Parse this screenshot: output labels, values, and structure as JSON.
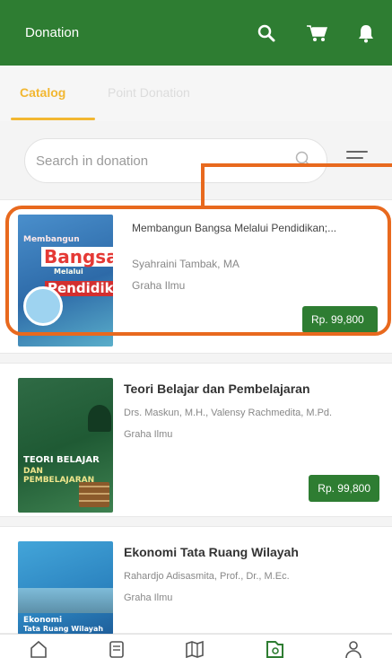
{
  "app": {
    "title": "Donation",
    "icons": [
      "search-icon",
      "cart-icon",
      "bell-icon"
    ]
  },
  "tabs": {
    "catalog": "Catalog",
    "point_donation": "Point Donation"
  },
  "search": {
    "placeholder": "Search in donation"
  },
  "books": [
    {
      "title": "Membangun Bangsa Melalui Pendidikan;...",
      "author": "Syahraini Tambak, MA",
      "publisher": "Graha Ilmu",
      "price": "Rp. 99,800",
      "cover_text": [
        "Membangun",
        "Bangsa",
        "Melalui",
        "Pendidikan"
      ]
    },
    {
      "title": "Teori Belajar dan Pembelajaran",
      "author": "Drs. Maskun, M.H., Valensy Rachmedita, M.Pd.",
      "publisher": "Graha Ilmu",
      "price": "Rp. 99,800",
      "cover_text": [
        "TEORI BELAJAR",
        "DAN PEMBELAJARAN"
      ]
    },
    {
      "title": "Ekonomi Tata Ruang Wilayah",
      "author": "Rahardjo Adisasmita, Prof., Dr., M.Ec.",
      "publisher": "Graha Ilmu",
      "cover_text": [
        "Ekonomi",
        "Tata Ruang Wilayah"
      ]
    }
  ],
  "bottom_nav": [
    "home-icon",
    "document-icon",
    "map-icon",
    "donation-icon",
    "profile-icon"
  ],
  "colors": {
    "primary": "#2e7d32",
    "accent": "#f2b731",
    "highlight": "#e8691e"
  }
}
